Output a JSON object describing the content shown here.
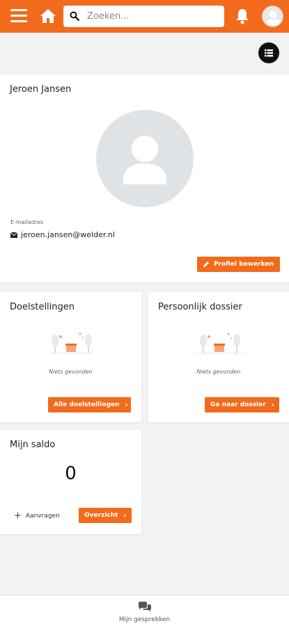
{
  "colors": {
    "accent": "#f26b1d",
    "background": "#f2f2f2",
    "card": "#ffffff"
  },
  "header": {
    "search_placeholder": "Zoeken...",
    "icons": [
      "menu-icon",
      "home-icon",
      "search-icon",
      "bell-icon",
      "avatar"
    ]
  },
  "profile": {
    "name": "Jeroen Jansen",
    "email_label": "E-mailadres",
    "email": "jeroen.jansen@welder.nl",
    "edit_button": "Profiel bewerken"
  },
  "goals": {
    "title": "Doelstellingen",
    "empty_text": "Niets gevonden",
    "button": "Alle doelstellingen"
  },
  "dossier": {
    "title": "Persoonlijk dossier",
    "empty_text": "Niets gevonden",
    "button": "Ga naar dossier"
  },
  "saldo": {
    "title": "Mijn saldo",
    "value": "0",
    "request_label": "Aanvragen",
    "overview_button": "Overzicht"
  },
  "bottom_nav": {
    "label": "Mijn gesprekken"
  }
}
